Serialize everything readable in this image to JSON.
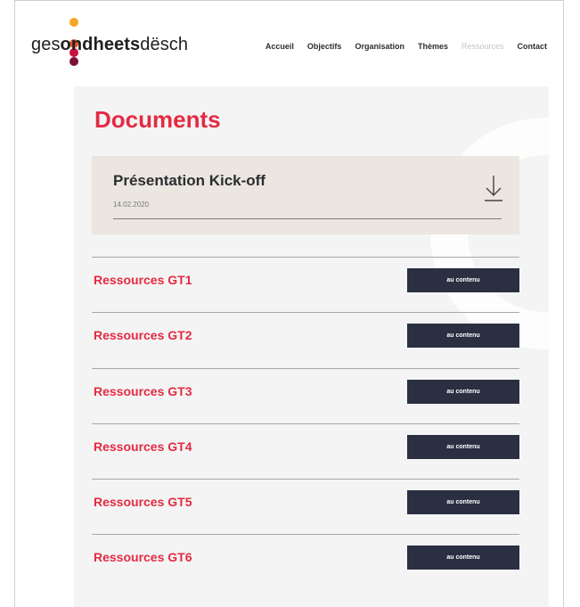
{
  "logo": {
    "text_prefix": "ges",
    "text_bold": "ondheets",
    "text_suffix": "dësch",
    "dot_colors": [
      "#f5a623",
      "#e8532b",
      "#c8143c",
      "#7a1238"
    ]
  },
  "nav": {
    "items": [
      "Accueil",
      "Objectifs",
      "Organisation",
      "Thèmes",
      "Ressources",
      "Contact"
    ],
    "active": "Ressources"
  },
  "page": {
    "title": "Documents"
  },
  "kickoff": {
    "title": "Présentation Kick-off",
    "date": "14.02.2020",
    "icon": "download-arrow-icon"
  },
  "resources": [
    {
      "label": "Ressources GT1",
      "button": "au contenu"
    },
    {
      "label": "Ressources GT2",
      "button": "au contenu"
    },
    {
      "label": "Ressources GT3",
      "button": "au contenu"
    },
    {
      "label": "Ressources GT4",
      "button": "au contenu"
    },
    {
      "label": "Ressources GT5",
      "button": "au contenu"
    },
    {
      "label": "Ressources GT6",
      "button": "au contenu"
    }
  ],
  "colors": {
    "accent": "#e32b43",
    "button_bg": "#2a2f42",
    "card_bg": "#ebe6df",
    "page_bg": "#f4f4f4"
  }
}
